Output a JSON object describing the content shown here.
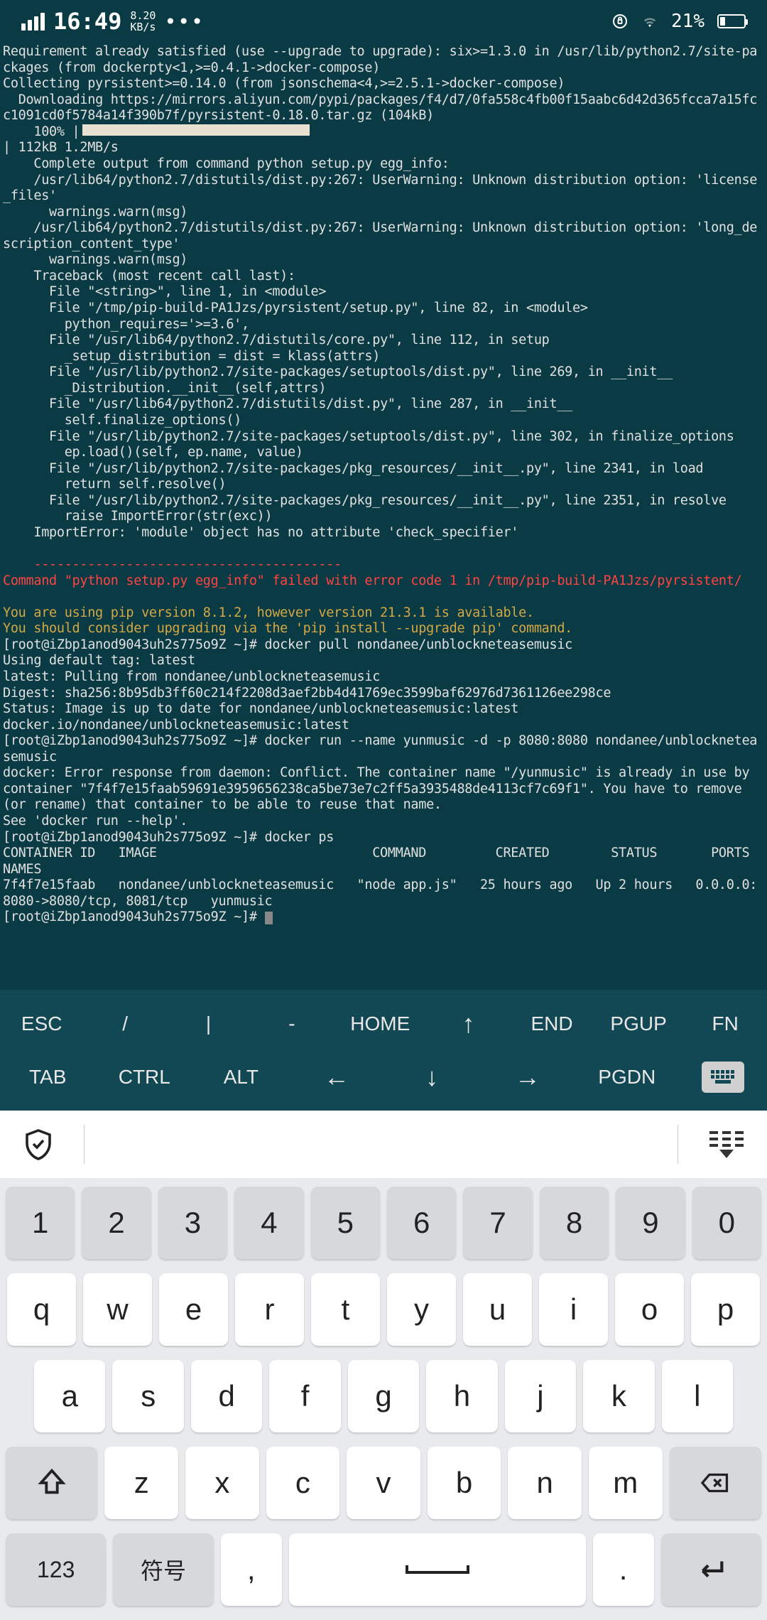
{
  "status": {
    "time": "16:49",
    "speed_val": "8.20",
    "speed_unit": "KB/s",
    "battery_pct": "21%"
  },
  "terminal": {
    "lines_white_1": [
      "Requirement already satisfied (use --upgrade to upgrade): six>=1.3.0 in /usr/lib/python2.7/site-packages (from dockerpty<1,>=0.4.1->docker-compose)",
      "Collecting pyrsistent>=0.14.0 (from jsonschema<4,>=2.5.1->docker-compose)",
      "  Downloading https://mirrors.aliyun.com/pypi/packages/f4/d7/0fa558c4fb00f15aabc6d42d365fcca7a15fcc1091cd0f5784a14f390b7f/pyrsistent-0.18.0.tar.gz (104kB)"
    ],
    "progress_pct": "100%",
    "progress_after": "| 112kB 1.2MB/s",
    "lines_white_2": [
      "    Complete output from command python setup.py egg_info:",
      "    /usr/lib64/python2.7/distutils/dist.py:267: UserWarning: Unknown distribution option: 'license_files'",
      "      warnings.warn(msg)",
      "    /usr/lib64/python2.7/distutils/dist.py:267: UserWarning: Unknown distribution option: 'long_description_content_type'",
      "      warnings.warn(msg)",
      "    Traceback (most recent call last):",
      "      File \"<string>\", line 1, in <module>",
      "      File \"/tmp/pip-build-PA1Jzs/pyrsistent/setup.py\", line 82, in <module>",
      "        python_requires='>=3.6',",
      "      File \"/usr/lib64/python2.7/distutils/core.py\", line 112, in setup",
      "        _setup_distribution = dist = klass(attrs)",
      "      File \"/usr/lib/python2.7/site-packages/setuptools/dist.py\", line 269, in __init__",
      "        _Distribution.__init__(self,attrs)",
      "      File \"/usr/lib64/python2.7/distutils/dist.py\", line 287, in __init__",
      "        self.finalize_options()",
      "      File \"/usr/lib/python2.7/site-packages/setuptools/dist.py\", line 302, in finalize_options",
      "        ep.load()(self, ep.name, value)",
      "      File \"/usr/lib/python2.7/site-packages/pkg_resources/__init__.py\", line 2341, in load",
      "        return self.resolve()",
      "      File \"/usr/lib/python2.7/site-packages/pkg_resources/__init__.py\", line 2351, in resolve",
      "        raise ImportError(str(exc))",
      "    ImportError: 'module' object has no attribute 'check_specifier'",
      "    "
    ],
    "line_red_dashes": "    ----------------------------------------",
    "line_red": "Command \"python setup.py egg_info\" failed with error code 1 in /tmp/pip-build-PA1Jzs/pyrsistent/",
    "lines_yellow": [
      "You are using pip version 8.1.2, however version 21.3.1 is available.",
      "You should consider upgrading via the 'pip install --upgrade pip' command."
    ],
    "lines_white_3": [
      "[root@iZbp1anod9043uh2s775o9Z ~]# docker pull nondanee/unblockneteasemusic",
      "Using default tag: latest",
      "latest: Pulling from nondanee/unblockneteasemusic",
      "Digest: sha256:8b95db3ff60c214f2208d3aef2bb4d41769ec3599baf62976d7361126ee298ce",
      "Status: Image is up to date for nondanee/unblockneteasemusic:latest",
      "docker.io/nondanee/unblockneteasemusic:latest",
      "[root@iZbp1anod9043uh2s775o9Z ~]# docker run --name yunmusic -d -p 8080:8080 nondanee/unblockneteasemusic",
      "docker: Error response from daemon: Conflict. The container name \"/yunmusic\" is already in use by container \"7f4f7e15faab59691e3959656238ca5be73e7c2ff5a3935488de4113cf7c69f1\". You have to remove (or rename) that container to be able to reuse that name.",
      "See 'docker run --help'.",
      "[root@iZbp1anod9043uh2s775o9Z ~]# docker ps",
      "CONTAINER ID   IMAGE                            COMMAND         CREATED        STATUS       PORTS                                NAMES",
      "7f4f7e15faab   nondanee/unblockneteasemusic   \"node app.js\"   25 hours ago   Up 2 hours   0.0.0.0:8080->8080/tcp, 8081/tcp   yunmusic"
    ],
    "prompt_final": "[root@iZbp1anod9043uh2s775o9Z ~]# "
  },
  "term_keys": {
    "row1": [
      "ESC",
      "/",
      "|",
      "-",
      "HOME",
      "↑",
      "END",
      "PGUP",
      "FN"
    ],
    "row2": [
      "TAB",
      "CTRL",
      "ALT",
      "←",
      "↓",
      "→",
      "PGDN"
    ]
  },
  "keyboard": {
    "row_num": [
      "1",
      "2",
      "3",
      "4",
      "5",
      "6",
      "7",
      "8",
      "9",
      "0"
    ],
    "row_q": [
      "q",
      "w",
      "e",
      "r",
      "t",
      "y",
      "u",
      "i",
      "o",
      "p"
    ],
    "row_a": [
      "a",
      "s",
      "d",
      "f",
      "g",
      "h",
      "j",
      "k",
      "l"
    ],
    "row_z": [
      "z",
      "x",
      "c",
      "v",
      "b",
      "n",
      "m"
    ],
    "key_123": "123",
    "key_sym": "符号",
    "key_comma": ",",
    "key_period": "."
  }
}
